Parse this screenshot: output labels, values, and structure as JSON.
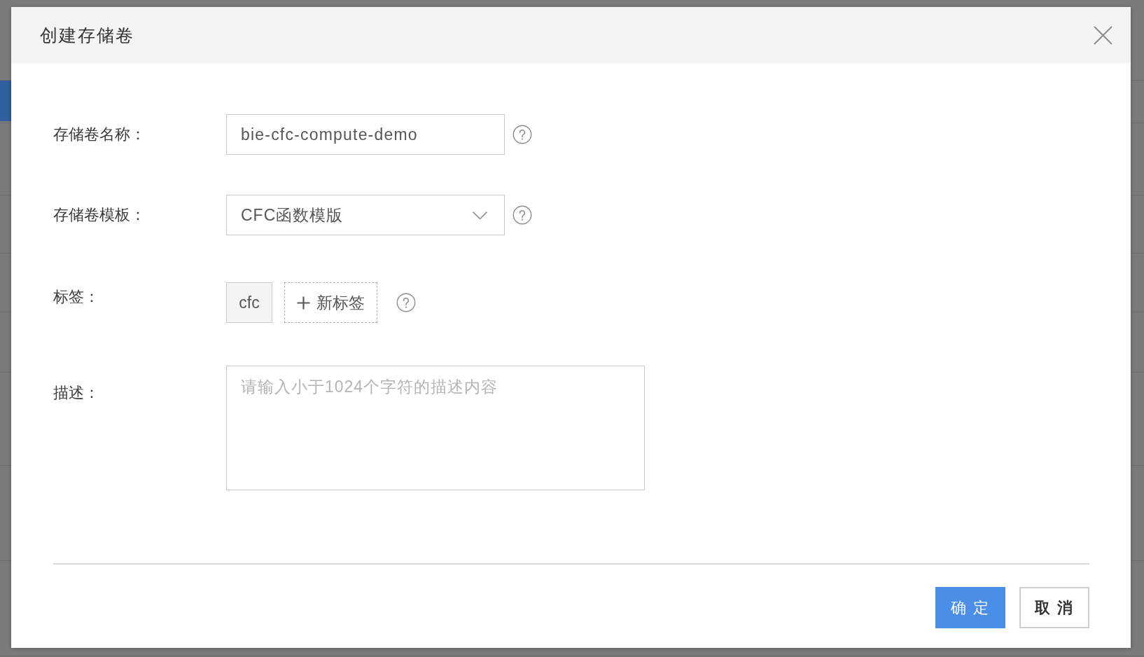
{
  "dialog": {
    "title": "创建存储卷",
    "fields": [
      {
        "kind": "text",
        "label": "存储卷名称：",
        "value": "bie-cfc-compute-demo",
        "help": true
      },
      {
        "kind": "select",
        "label": "存储卷模板：",
        "value": "CFC函数模版",
        "help": true
      },
      {
        "kind": "tags",
        "label": "标签：",
        "tags": [
          "cfc"
        ],
        "add_label": "新标签",
        "help": true
      },
      {
        "kind": "textarea",
        "label": "描述：",
        "placeholder": "请输入小于1024个字符的描述内容"
      }
    ],
    "buttons": [
      {
        "kind": "primary",
        "label": "确 定"
      },
      {
        "kind": "default",
        "label": "取 消"
      }
    ]
  }
}
